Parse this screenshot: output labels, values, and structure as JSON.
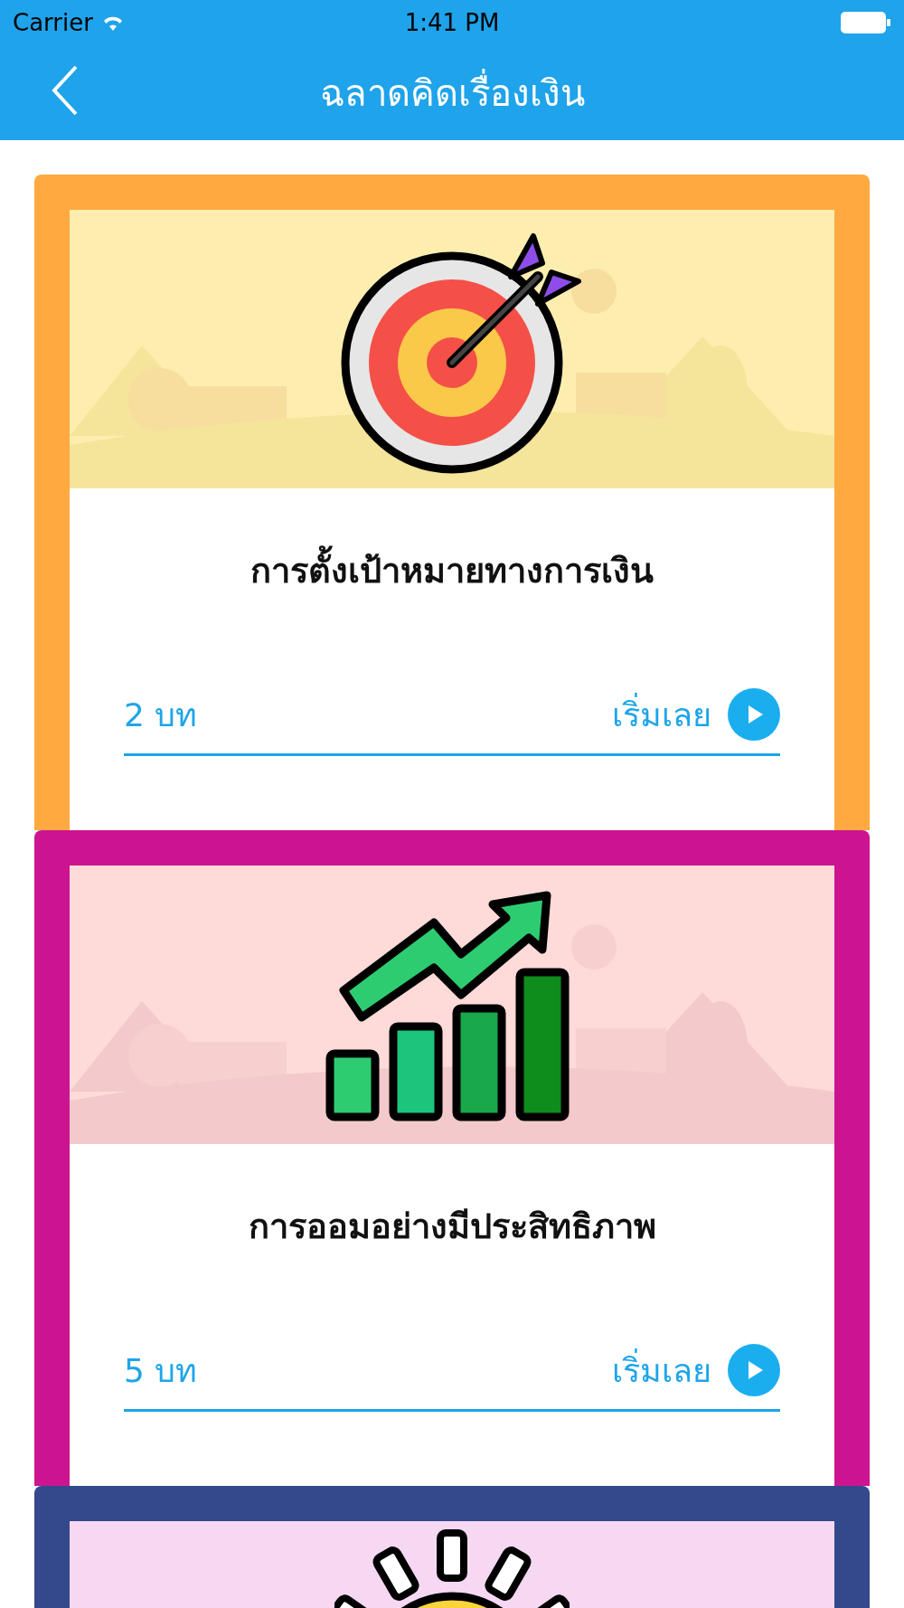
{
  "status_bar": {
    "carrier": "Carrier",
    "time": "1:41 PM"
  },
  "nav": {
    "title": "ฉลาดคิดเรื่องเงิน"
  },
  "courses": [
    {
      "kind": "target",
      "color": "#ffa940",
      "title": "การตั้งเป้าหมายทางการเงิน",
      "lessons": "2 บท",
      "action": "เริ่มเลย"
    },
    {
      "kind": "growth",
      "color": "#cc1490",
      "title": "การออมอย่างมีประสิทธิภาพ",
      "lessons": "5 บท",
      "action": "เริ่มเลย"
    },
    {
      "kind": "sun",
      "color": "#34498c"
    }
  ]
}
